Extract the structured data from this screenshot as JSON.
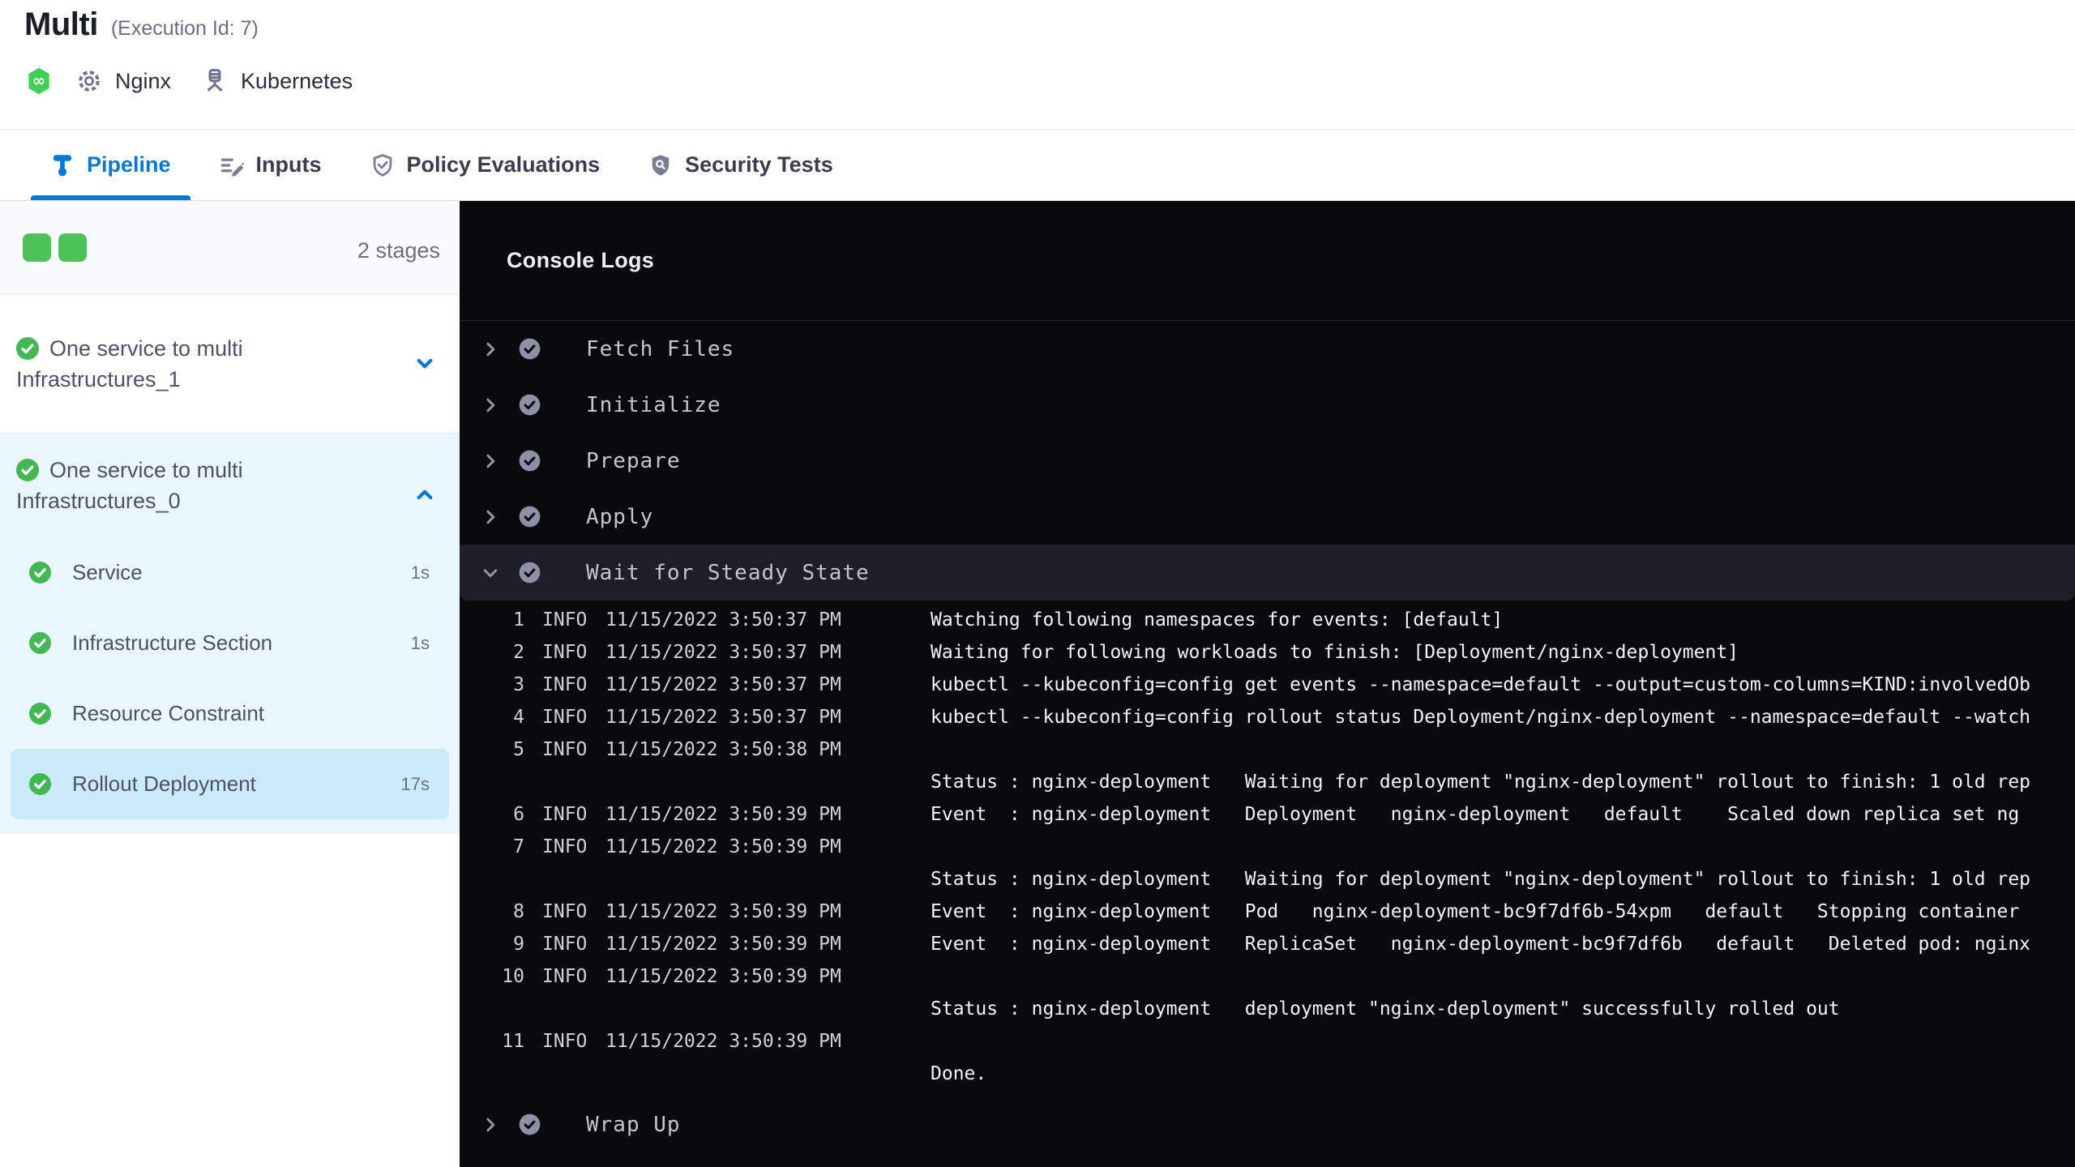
{
  "header": {
    "title": "Multi",
    "execution_id": "(Execution Id: 7)",
    "service_label": "Nginx",
    "environment_label": "Kubernetes",
    "service_icon": "gear-icon",
    "pipeline_icon": "deployment-hex-icon",
    "environment_icon": "environment-icon"
  },
  "tabs": [
    {
      "label": "Pipeline",
      "icon": "pipeline-icon",
      "active": true
    },
    {
      "label": "Inputs",
      "icon": "inputs-icon",
      "active": false
    },
    {
      "label": "Policy Evaluations",
      "icon": "policy-shield-check-icon",
      "active": false
    },
    {
      "label": "Security Tests",
      "icon": "security-shield-search-icon",
      "active": false
    }
  ],
  "sidebar": {
    "stage_count_label": "2 stages",
    "status_squares": 2,
    "stages": [
      {
        "name": "One service to multi Infrastructures_1",
        "status": "success",
        "expanded": false,
        "steps": []
      },
      {
        "name": "One service to multi Infrastructures_0",
        "status": "success",
        "expanded": true,
        "steps": [
          {
            "name": "Service",
            "duration": "1s",
            "status": "success",
            "selected": false
          },
          {
            "name": "Infrastructure Section",
            "duration": "1s",
            "status": "success",
            "selected": false
          },
          {
            "name": "Resource Constraint",
            "duration": "",
            "status": "success",
            "selected": false
          },
          {
            "name": "Rollout Deployment",
            "duration": "17s",
            "status": "success",
            "selected": true
          }
        ]
      }
    ]
  },
  "console": {
    "title": "Console Logs",
    "steps": [
      {
        "name": "Fetch Files",
        "status": "success",
        "expanded": false
      },
      {
        "name": "Initialize",
        "status": "success",
        "expanded": false
      },
      {
        "name": "Prepare",
        "status": "success",
        "expanded": false
      },
      {
        "name": "Apply",
        "status": "success",
        "expanded": false
      },
      {
        "name": "Wait for Steady State",
        "status": "success",
        "expanded": true
      },
      {
        "name": "Wrap Up",
        "status": "success",
        "expanded": false
      }
    ],
    "logs": [
      {
        "num": "1",
        "level": "INFO",
        "time": "11/15/2022 3:50:37 PM",
        "msg": "Watching following namespaces for events: [default]"
      },
      {
        "num": "2",
        "level": "INFO",
        "time": "11/15/2022 3:50:37 PM",
        "msg": "Waiting for following workloads to finish: [Deployment/nginx-deployment]"
      },
      {
        "num": "3",
        "level": "INFO",
        "time": "11/15/2022 3:50:37 PM",
        "msg": "kubectl --kubeconfig=config get events --namespace=default --output=custom-columns=KIND:involvedOb"
      },
      {
        "num": "4",
        "level": "INFO",
        "time": "11/15/2022 3:50:37 PM",
        "msg": "kubectl --kubeconfig=config rollout status Deployment/nginx-deployment --namespace=default --watch"
      },
      {
        "num": "5",
        "level": "INFO",
        "time": "11/15/2022 3:50:38 PM",
        "msg": ""
      },
      {
        "num": "",
        "level": "",
        "time": "",
        "msg": "Status : nginx-deployment   Waiting for deployment \"nginx-deployment\" rollout to finish: 1 old rep"
      },
      {
        "num": "6",
        "level": "INFO",
        "time": "11/15/2022 3:50:39 PM",
        "msg": "Event  : nginx-deployment   Deployment   nginx-deployment   default    Scaled down replica set ng"
      },
      {
        "num": "7",
        "level": "INFO",
        "time": "11/15/2022 3:50:39 PM",
        "msg": ""
      },
      {
        "num": "",
        "level": "",
        "time": "",
        "msg": "Status : nginx-deployment   Waiting for deployment \"nginx-deployment\" rollout to finish: 1 old rep"
      },
      {
        "num": "8",
        "level": "INFO",
        "time": "11/15/2022 3:50:39 PM",
        "msg": "Event  : nginx-deployment   Pod   nginx-deployment-bc9f7df6b-54xpm   default   Stopping container"
      },
      {
        "num": "9",
        "level": "INFO",
        "time": "11/15/2022 3:50:39 PM",
        "msg": "Event  : nginx-deployment   ReplicaSet   nginx-deployment-bc9f7df6b   default   Deleted pod: nginx"
      },
      {
        "num": "10",
        "level": "INFO",
        "time": "11/15/2022 3:50:39 PM",
        "msg": ""
      },
      {
        "num": "",
        "level": "",
        "time": "",
        "msg": "Status : nginx-deployment   deployment \"nginx-deployment\" successfully rolled out"
      },
      {
        "num": "11",
        "level": "INFO",
        "time": "11/15/2022 3:50:39 PM",
        "msg": ""
      },
      {
        "num": "",
        "level": "",
        "time": "",
        "msg": "Done."
      }
    ]
  },
  "colors": {
    "accent_blue": "#0278d5",
    "success_green": "#42b754",
    "square_green": "#4ec158",
    "stage_expanded_bg": "#eaf6fd",
    "step_selected_bg": "#cbeafb",
    "console_bg": "#0a0a0d",
    "console_row_bg": "#1e1e26"
  }
}
